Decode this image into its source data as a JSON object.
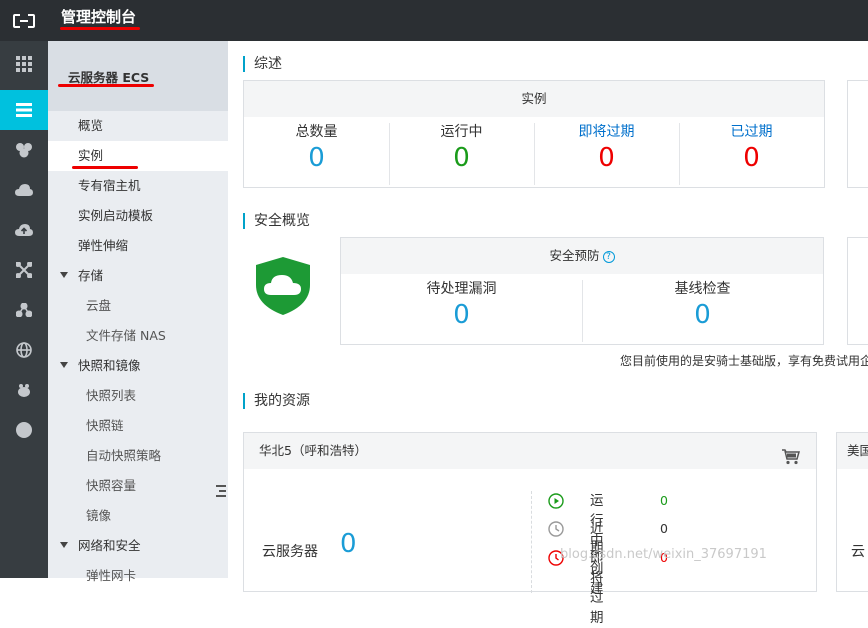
{
  "topbar": {
    "console_title": "管理控制台",
    "logo_icon": "aliyun-logo-icon"
  },
  "rail": {
    "items": [
      {
        "icon": "grid-icon"
      },
      {
        "icon": "server-icon",
        "active": true
      },
      {
        "icon": "cluster-icon"
      },
      {
        "icon": "cloud-gear-icon"
      },
      {
        "icon": "cloud-upload-icon"
      },
      {
        "icon": "network-icon"
      },
      {
        "icon": "nodes-icon"
      },
      {
        "icon": "globe-icon"
      },
      {
        "icon": "bug-icon"
      },
      {
        "icon": "circle-icon"
      }
    ]
  },
  "nav": {
    "title": "云服务器 ECS",
    "items": [
      {
        "label": "概览"
      },
      {
        "label": "实例",
        "active": true
      },
      {
        "label": "专有宿主机"
      },
      {
        "label": "实例启动模板"
      },
      {
        "label": "弹性伸缩"
      },
      {
        "label": "存储",
        "group": true
      },
      {
        "label": "云盘",
        "sub": true
      },
      {
        "label": "文件存储 NAS",
        "sub": true
      },
      {
        "label": "快照和镜像",
        "group": true
      },
      {
        "label": "快照列表",
        "sub": true
      },
      {
        "label": "快照链",
        "sub": true
      },
      {
        "label": "自动快照策略",
        "sub": true
      },
      {
        "label": "快照容量",
        "sub": true
      },
      {
        "label": "镜像",
        "sub": true
      },
      {
        "label": "网络和安全",
        "group": true
      },
      {
        "label": "弹性网卡",
        "sub": true
      }
    ]
  },
  "overview": {
    "title": "综述",
    "instance_card": {
      "head": "实例",
      "stats": [
        {
          "label": "总数量",
          "value": "0"
        },
        {
          "label": "运行中",
          "value": "0"
        },
        {
          "label": "即将过期",
          "value": "0"
        },
        {
          "label": "已过期",
          "value": "0"
        }
      ]
    }
  },
  "security": {
    "title": "安全概览",
    "card": {
      "head": "安全预防",
      "help_icon": "?",
      "stats": [
        {
          "label": "待处理漏洞",
          "value": "0"
        },
        {
          "label": "基线检查",
          "value": "0"
        }
      ]
    },
    "notice": "您目前使用的是安骑士基础版，享有免费试用企"
  },
  "resources": {
    "title": "我的资源",
    "region_card": {
      "region": "华北5（呼和浩特）",
      "server_label": "云服务器",
      "server_count": "0",
      "statuses": [
        {
          "label": "运行中",
          "count": "0",
          "icon": "play-circle-icon"
        },
        {
          "label": "近期创建",
          "count": "0",
          "icon": "clock-icon"
        },
        {
          "label": "即将过期",
          "count": "0",
          "icon": "alarm-icon"
        }
      ]
    },
    "second_card": {
      "region": "美国",
      "server_label": "云"
    }
  },
  "watermark": "blog.csdn.net/weixin_37697191",
  "colors": {
    "accent": "#00c1de",
    "blue": "#1a9cd6",
    "green": "#1a9b1a",
    "red": "#ee0000",
    "link": "#0070cc"
  }
}
